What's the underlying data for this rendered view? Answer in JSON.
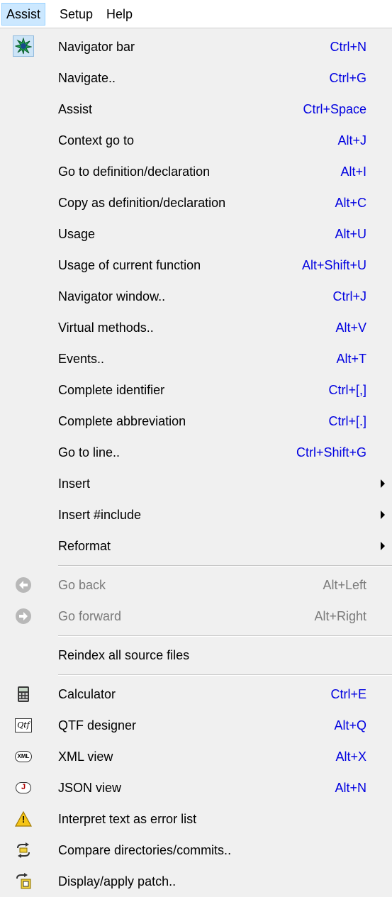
{
  "menubar": {
    "items": [
      {
        "label": "Assist"
      },
      {
        "label": "Setup"
      },
      {
        "label": "Help"
      }
    ]
  },
  "menu": {
    "items": [
      {
        "label": "Navigator bar",
        "shortcut": "Ctrl+N",
        "icon": "navigator-bar-icon"
      },
      {
        "label": "Navigate..",
        "shortcut": "Ctrl+G"
      },
      {
        "label": "Assist",
        "shortcut": "Ctrl+Space"
      },
      {
        "label": "Context go to",
        "shortcut": "Alt+J"
      },
      {
        "label": "Go to definition/declaration",
        "shortcut": "Alt+I"
      },
      {
        "label": "Copy as definition/declaration",
        "shortcut": "Alt+C"
      },
      {
        "label": "Usage",
        "shortcut": "Alt+U"
      },
      {
        "label": "Usage of current function",
        "shortcut": "Alt+Shift+U"
      },
      {
        "label": "Navigator window..",
        "shortcut": "Ctrl+J"
      },
      {
        "label": "Virtual methods..",
        "shortcut": "Alt+V"
      },
      {
        "label": "Events..",
        "shortcut": "Alt+T"
      },
      {
        "label": "Complete identifier",
        "shortcut": "Ctrl+[,]"
      },
      {
        "label": "Complete abbreviation",
        "shortcut": "Ctrl+[.]"
      },
      {
        "label": "Go to line..",
        "shortcut": "Ctrl+Shift+G"
      },
      {
        "label": "Insert",
        "submenu": true
      },
      {
        "label": "Insert #include",
        "submenu": true
      },
      {
        "label": "Reformat",
        "submenu": true
      },
      {
        "label": "Go back",
        "shortcut": "Alt+Left",
        "disabled": true,
        "icon": "back-arrow-icon"
      },
      {
        "label": "Go forward",
        "shortcut": "Alt+Right",
        "disabled": true,
        "icon": "forward-arrow-icon"
      },
      {
        "label": "Reindex all source files"
      },
      {
        "label": "Calculator",
        "shortcut": "Ctrl+E",
        "icon": "calculator-icon"
      },
      {
        "label": "QTF designer",
        "shortcut": "Alt+Q",
        "icon": "qtf-icon",
        "icon_text": "Qtf"
      },
      {
        "label": "XML view",
        "shortcut": "Alt+X",
        "icon": "xml-icon",
        "icon_text": "XML"
      },
      {
        "label": "JSON view",
        "shortcut": "Alt+N",
        "icon": "json-icon",
        "icon_text": "J"
      },
      {
        "label": "Interpret text as error list",
        "icon": "warning-icon",
        "icon_text": "!"
      },
      {
        "label": "Compare directories/commits..",
        "icon": "compare-icon"
      },
      {
        "label": "Display/apply patch..",
        "icon": "patch-icon"
      }
    ]
  },
  "colors": {
    "shortcut": "#0000e0",
    "disabled": "#7a7a7a",
    "menubar_active": "#cce8ff"
  }
}
